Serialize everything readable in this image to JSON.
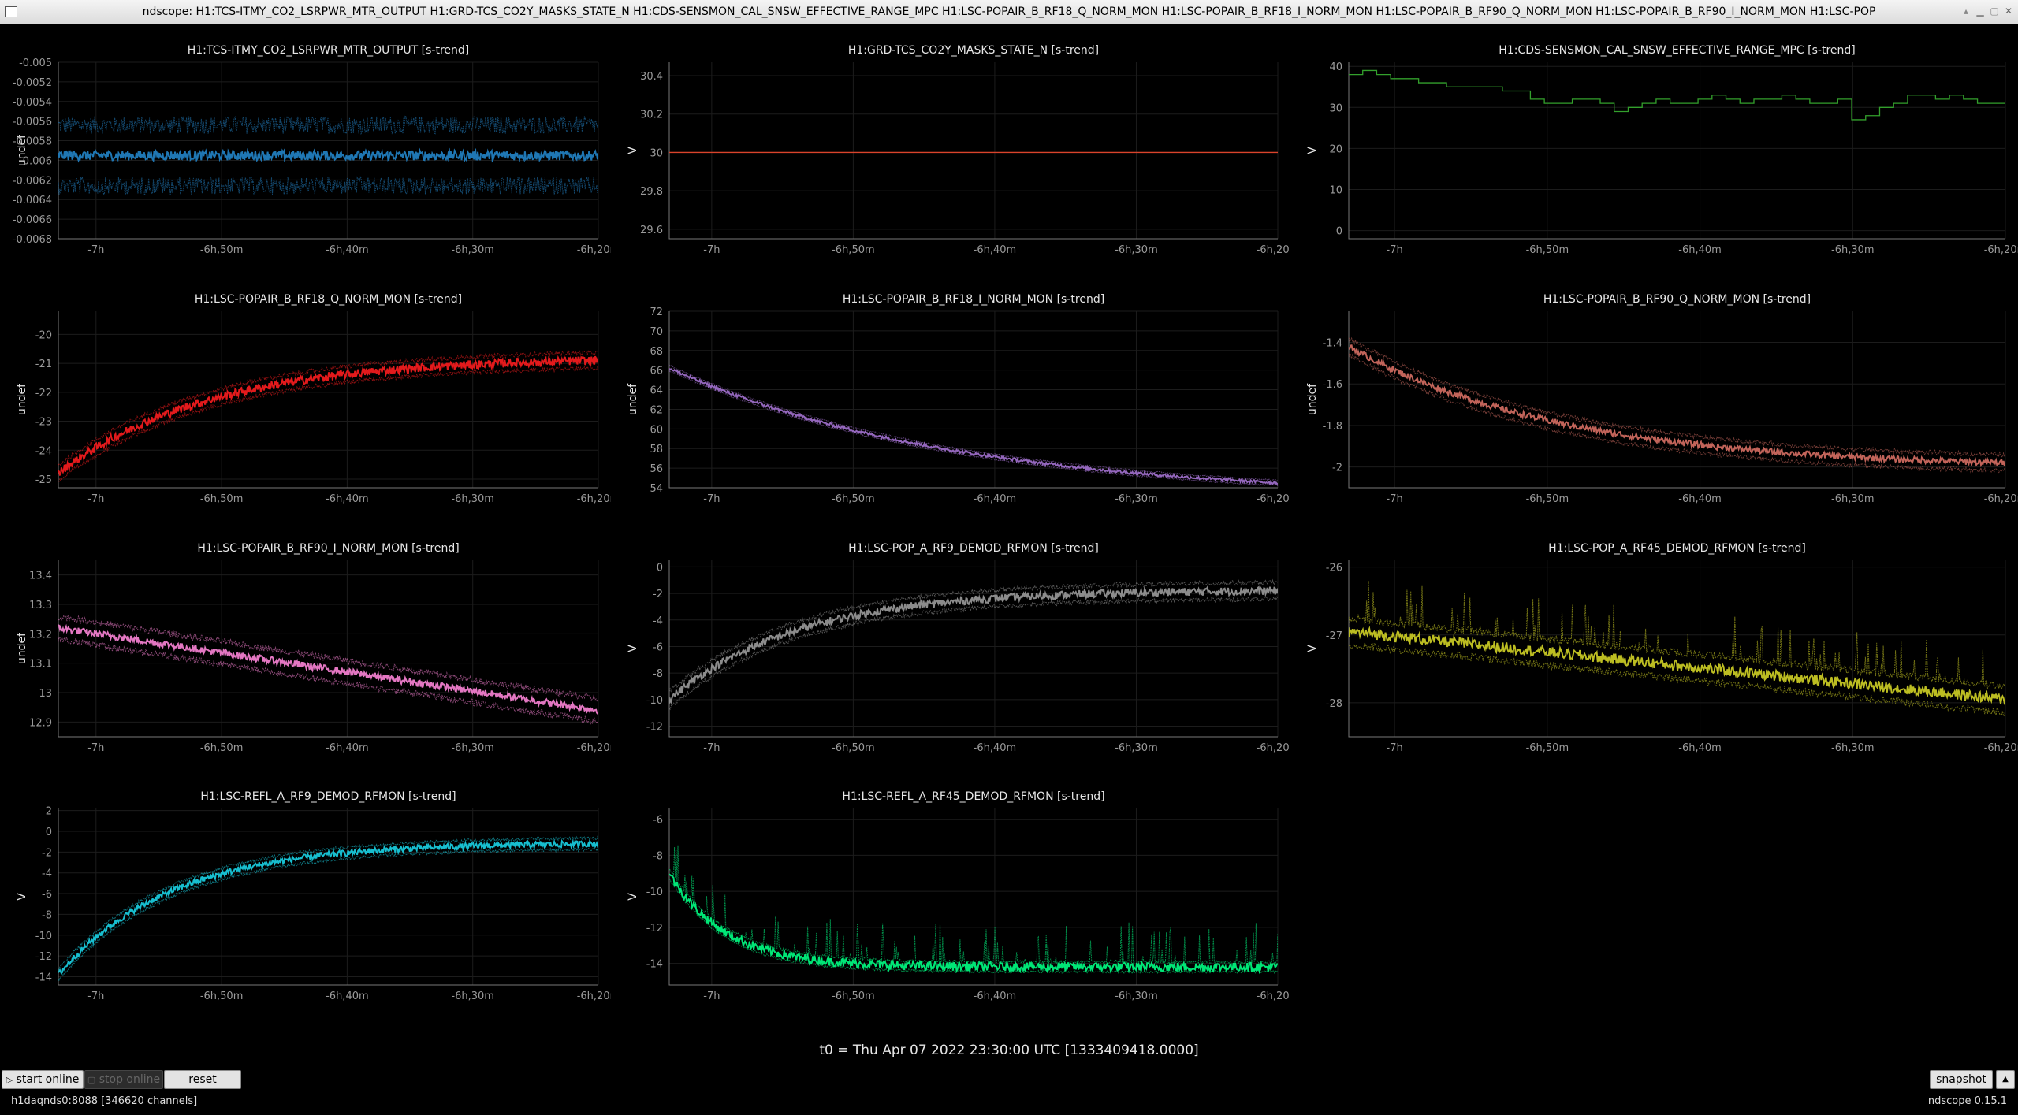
{
  "window": {
    "title": "ndscope: H1:TCS-ITMY_CO2_LSRPWR_MTR_OUTPUT H1:GRD-TCS_CO2Y_MASKS_STATE_N H1:CDS-SENSMON_CAL_SNSW_EFFECTIVE_RANGE_MPC H1:LSC-POPAIR_B_RF18_Q_NORM_MON H1:LSC-POPAIR_B_RF18_I_NORM_MON H1:LSC-POPAIR_B_RF90_Q_NORM_MON H1:LSC-POPAIR_B_RF90_I_NORM_MON H1:LSC-POP"
  },
  "t0": "t0 = Thu Apr 07 2022 23:30:00 UTC [1333409418.0000]",
  "buttons": {
    "start_online": "start online",
    "stop_online": "stop online",
    "reset": "reset",
    "snapshot": "snapshot"
  },
  "icons": {
    "start": "play-icon",
    "stop": "stop-icon"
  },
  "status": {
    "server": "h1daqnds0:8088  [346620 channels]",
    "version": "ndscope 0.15.1"
  },
  "x_ticks": [
    "-7h",
    "-6h,50m",
    "-6h,40m",
    "-6h,30m",
    "-6h,20m"
  ],
  "x_tick_values_min": [
    -420,
    -410,
    -400,
    -390,
    -380
  ],
  "x_range_min": [
    -423,
    -380
  ],
  "plots": [
    {
      "title": "H1:TCS-ITMY_CO2_LSRPWR_MTR_OUTPUT [s-trend]",
      "ylabel": "undef",
      "color": "#1f77b4",
      "ylim": [
        -0.0068,
        -0.005
      ],
      "yticks": [
        -0.005,
        -0.0052,
        -0.0054,
        -0.0056,
        -0.0058,
        -0.006,
        -0.0062,
        -0.0064,
        -0.0066,
        -0.0068
      ],
      "ytick_labels": [
        "-0.005",
        "-0.0052",
        "-0.0054",
        "-0.0056",
        "-0.0058",
        "-0.006",
        "-0.0062",
        "-0.0064",
        "-0.0066",
        "-0.0068"
      ],
      "trend": {
        "kind": "flat",
        "start": -0.00595,
        "end": -0.00595
      },
      "noise": 5e-05,
      "env": 0.0004,
      "spike": 0
    },
    {
      "title": "H1:GRD-TCS_CO2Y_MASKS_STATE_N [s-trend]",
      "ylabel": "V",
      "color": "#d9432b",
      "ylim": [
        29.55,
        30.47
      ],
      "yticks": [
        30.4,
        30.2,
        30,
        29.8,
        29.6
      ],
      "ytick_labels": [
        "30.4",
        "30.2",
        "30",
        "29.8",
        "29.6"
      ],
      "trend": {
        "kind": "flat",
        "start": 30,
        "end": 30
      },
      "noise": 0,
      "env": 0,
      "spike": 0
    },
    {
      "title": "H1:CDS-SENSMON_CAL_SNSW_EFFECTIVE_RANGE_MPC [s-trend]",
      "ylabel": "V",
      "color": "#33a02c",
      "ylim": [
        -2,
        41
      ],
      "yticks": [
        40,
        30,
        20,
        10,
        0
      ],
      "ytick_labels": [
        "40",
        "30",
        "20",
        "10",
        "0"
      ],
      "steps": [
        38,
        39,
        38,
        37,
        37,
        36,
        36,
        35,
        35,
        35,
        35,
        34,
        34,
        32,
        31,
        31,
        32,
        32,
        31,
        29,
        30,
        31,
        32,
        31,
        31,
        32,
        33,
        32,
        31,
        32,
        32,
        33,
        32,
        31,
        31,
        32,
        27,
        28,
        30,
        31,
        33,
        33,
        32,
        33,
        32,
        31,
        31
      ],
      "trend": {
        "kind": "flat",
        "start": 32,
        "end": 32
      },
      "noise": 0,
      "env": 0,
      "spike": 0
    },
    {
      "title": "H1:LSC-POPAIR_B_RF18_Q_NORM_MON [s-trend]",
      "ylabel": "undef",
      "color": "#e31a1c",
      "ylim": [
        -25.3,
        -19.2
      ],
      "yticks": [
        -20,
        -21,
        -22,
        -23,
        -24,
        -25
      ],
      "ytick_labels": [
        "-20",
        "-21",
        "-22",
        "-23",
        "-24",
        "-25"
      ],
      "trend": {
        "kind": "rise",
        "start": -24.8,
        "end": -20.9,
        "tau": 12
      },
      "noise": 0.15,
      "env": 0.35,
      "spike": 0
    },
    {
      "title": "H1:LSC-POPAIR_B_RF18_I_NORM_MON [s-trend]",
      "ylabel": "undef",
      "color": "#9467bd",
      "ylim": [
        54,
        72
      ],
      "yticks": [
        72,
        70,
        68,
        66,
        64,
        62,
        60,
        58,
        56,
        54
      ],
      "ytick_labels": [
        "72",
        "70",
        "68",
        "66",
        "64",
        "62",
        "60",
        "58",
        "56",
        "54"
      ],
      "trend": {
        "kind": "decay",
        "start": 66.2,
        "end": 54.5,
        "tau": 20
      },
      "noise": 0.15,
      "env": 0.35,
      "spike": 0
    },
    {
      "title": "H1:LSC-POPAIR_B_RF90_Q_NORM_MON [s-trend]",
      "ylabel": "undef",
      "color": "#c2645a",
      "ylim": [
        -2.1,
        -1.25
      ],
      "yticks": [
        -1.4,
        -1.6,
        -1.8,
        -2
      ],
      "ytick_labels": [
        "-1.4",
        "-1.6",
        "-1.8",
        "-2"
      ],
      "trend": {
        "kind": "decay",
        "start": -1.42,
        "end": -1.98,
        "tau": 14
      },
      "noise": 0.015,
      "env": 0.05,
      "spike": 0
    },
    {
      "title": "H1:LSC-POPAIR_B_RF90_I_NORM_MON [s-trend]",
      "ylabel": "undef",
      "color": "#e377c2",
      "ylim": [
        12.85,
        13.45
      ],
      "yticks": [
        13.4,
        13.3,
        13.2,
        13.1,
        13,
        12.9
      ],
      "ytick_labels": [
        "13.4",
        "13.3",
        "13.2",
        "13.1",
        "13",
        "12.9"
      ],
      "trend": {
        "kind": "linear",
        "start": 13.22,
        "end": 12.94
      },
      "noise": 0.012,
      "env": 0.05,
      "spike": 0
    },
    {
      "title": "H1:LSC-POP_A_RF9_DEMOD_RFMON [s-trend]",
      "ylabel": "V",
      "color": "#8c8c8c",
      "ylim": [
        -12.8,
        0.5
      ],
      "yticks": [
        0,
        -2,
        -4,
        -6,
        -8,
        -10,
        -12
      ],
      "ytick_labels": [
        "0",
        "-2",
        "-4",
        "-6",
        "-8",
        "-10",
        "-12"
      ],
      "trend": {
        "kind": "rise",
        "start": -10,
        "end": -1.8,
        "tau": 9
      },
      "noise": 0.3,
      "env": 0.8,
      "spike": 0
    },
    {
      "title": "H1:LSC-POP_A_RF45_DEMOD_RFMON [s-trend]",
      "ylabel": "V",
      "color": "#bcbd22",
      "ylim": [
        -28.5,
        -25.9
      ],
      "yticks": [
        -26,
        -27,
        -28
      ],
      "ytick_labels": [
        "-26",
        "-27",
        "-28"
      ],
      "trend": {
        "kind": "linear",
        "start": -26.95,
        "end": -27.95
      },
      "noise": 0.08,
      "env": 0.25,
      "spike": 0.6
    },
    {
      "title": "H1:LSC-REFL_A_RF9_DEMOD_RFMON [s-trend]",
      "ylabel": "V",
      "color": "#17becf",
      "ylim": [
        -14.8,
        2.2
      ],
      "yticks": [
        2,
        0,
        -2,
        -4,
        -6,
        -8,
        -10,
        -12,
        -14
      ],
      "ytick_labels": [
        "2",
        "0",
        "-2",
        "-4",
        "-6",
        "-8",
        "-10",
        "-12",
        "-14"
      ],
      "trend": {
        "kind": "rise",
        "start": -13.8,
        "end": -1.2,
        "tau": 9
      },
      "noise": 0.3,
      "env": 0.7,
      "spike": 0
    },
    {
      "title": "H1:LSC-REFL_A_RF45_DEMOD_RFMON [s-trend]",
      "ylabel": "V",
      "color": "#00e676",
      "ylim": [
        -15.2,
        -5.4
      ],
      "yticks": [
        -6,
        -8,
        -10,
        -12,
        -14
      ],
      "ytick_labels": [
        "-6",
        "-8",
        "-10",
        "-12",
        "-14"
      ],
      "trend": {
        "kind": "decay",
        "start": -9,
        "end": -14.2,
        "tau": 4
      },
      "noise": 0.25,
      "env": 0.35,
      "spike": 2.2
    }
  ]
}
